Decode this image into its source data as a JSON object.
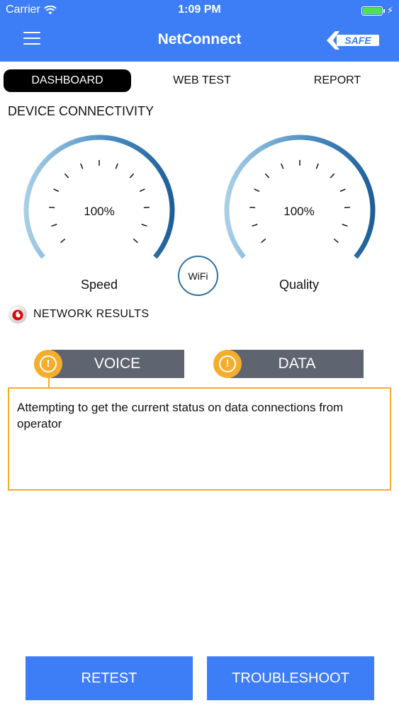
{
  "status_bar": {
    "carrier": "Carrier",
    "time": "1:09 PM",
    "wifi_icon": "wifi-icon",
    "battery_icon": "battery-icon",
    "charging_icon": "charging-bolt-icon"
  },
  "header": {
    "title": "NetConnect",
    "menu_icon": "hamburger-menu-icon",
    "logo_text": "SAFE"
  },
  "tabs": [
    {
      "label": "DASHBOARD",
      "active": true
    },
    {
      "label": "WEB TEST",
      "active": false
    },
    {
      "label": "REPORT",
      "active": false
    }
  ],
  "device_connectivity": {
    "title": "DEVICE CONNECTIVITY",
    "gauges": [
      {
        "label": "Speed",
        "value": "100%",
        "level": 1.0
      },
      {
        "label": "Quality",
        "value": "100%",
        "level": 1.0
      }
    ],
    "connection_type": "WiFi"
  },
  "network_results": {
    "title": "NETWORK RESULTS",
    "icon": "vodafone-logo-icon",
    "tabs": [
      {
        "label": "VOICE",
        "status_icon": "alert-icon",
        "selected": true
      },
      {
        "label": "DATA",
        "status_icon": "alert-icon",
        "selected": false
      }
    ],
    "message": "Attempting to get the current status on data connections from operator"
  },
  "actions": {
    "retest_label": "RETEST",
    "troubleshoot_label": "TROUBLESHOOT"
  },
  "colors": {
    "header": "#3d7ef6",
    "accent_orange": "#f5ad2e",
    "tab_gray": "#5e6470",
    "gauge_dark": "#1f5f99",
    "gauge_light": "#a8cfe6"
  }
}
